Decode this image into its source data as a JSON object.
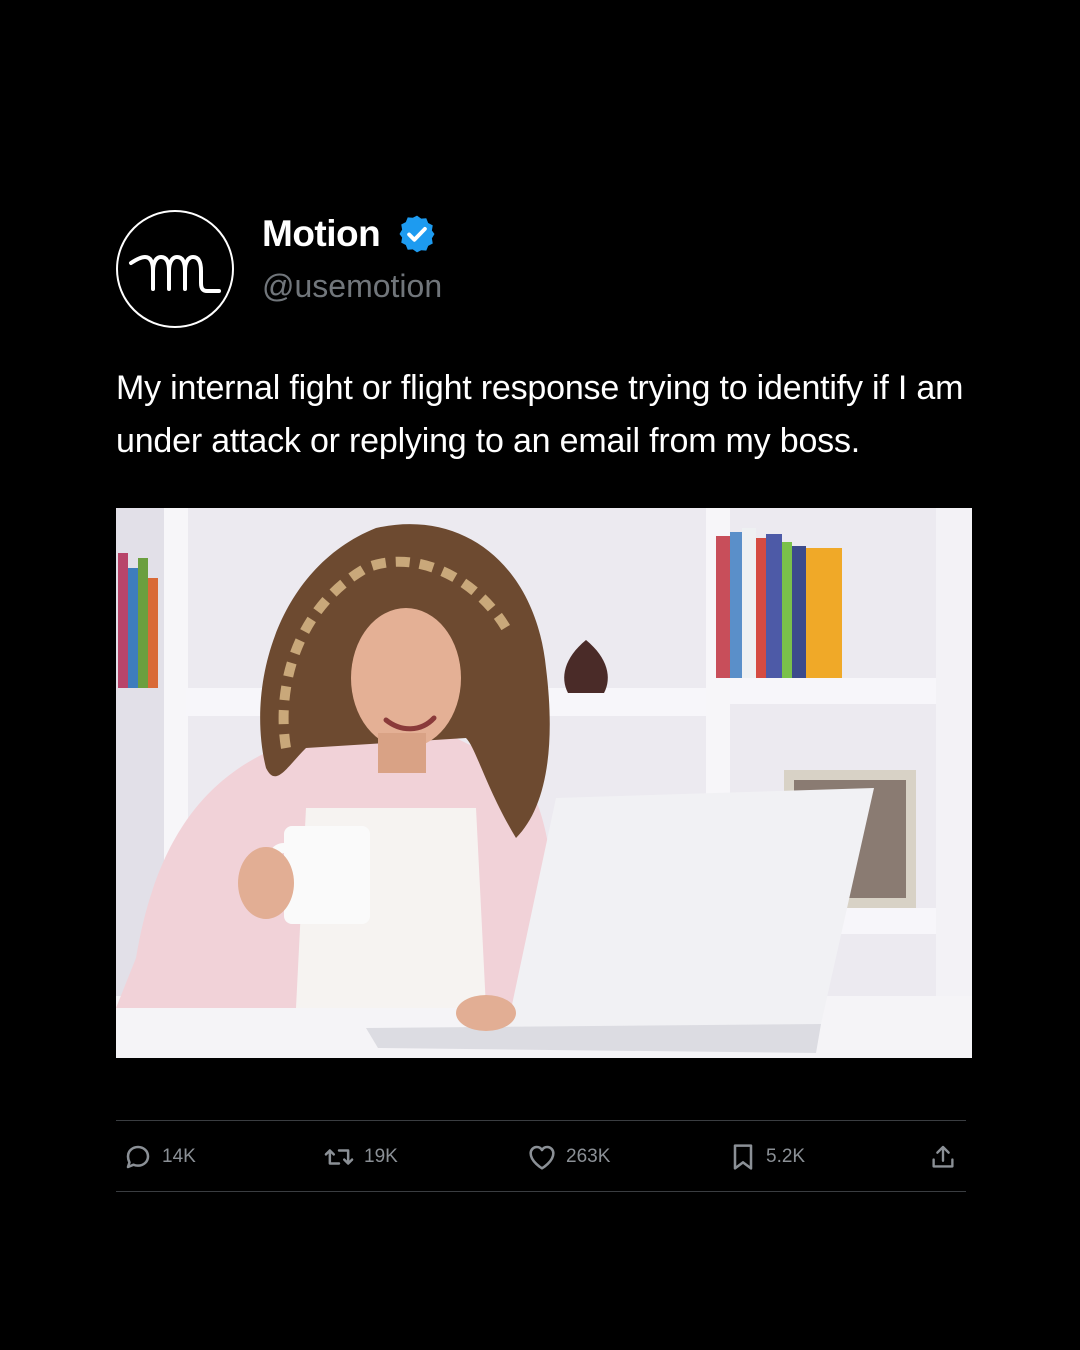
{
  "account": {
    "display_name": "Motion",
    "handle": "@usemotion",
    "verified_color": "#1d9bf0"
  },
  "tweet": {
    "text": "My internal fight or flight response trying to identify if I am under attack or replying to an email from my boss."
  },
  "media": {
    "description_icon": "photo"
  },
  "actions": {
    "reply": {
      "icon": "reply-icon",
      "count": "14K"
    },
    "retweet": {
      "icon": "retweet-icon",
      "count": "19K"
    },
    "like": {
      "icon": "heart-icon",
      "count": "263K"
    },
    "bookmark": {
      "icon": "bookmark-icon",
      "count": "5.2K"
    },
    "share": {
      "icon": "share-icon"
    }
  },
  "colors": {
    "background": "#000000",
    "text_primary": "#ffffff",
    "text_secondary": "#71767b",
    "divider": "#3a3d41"
  }
}
